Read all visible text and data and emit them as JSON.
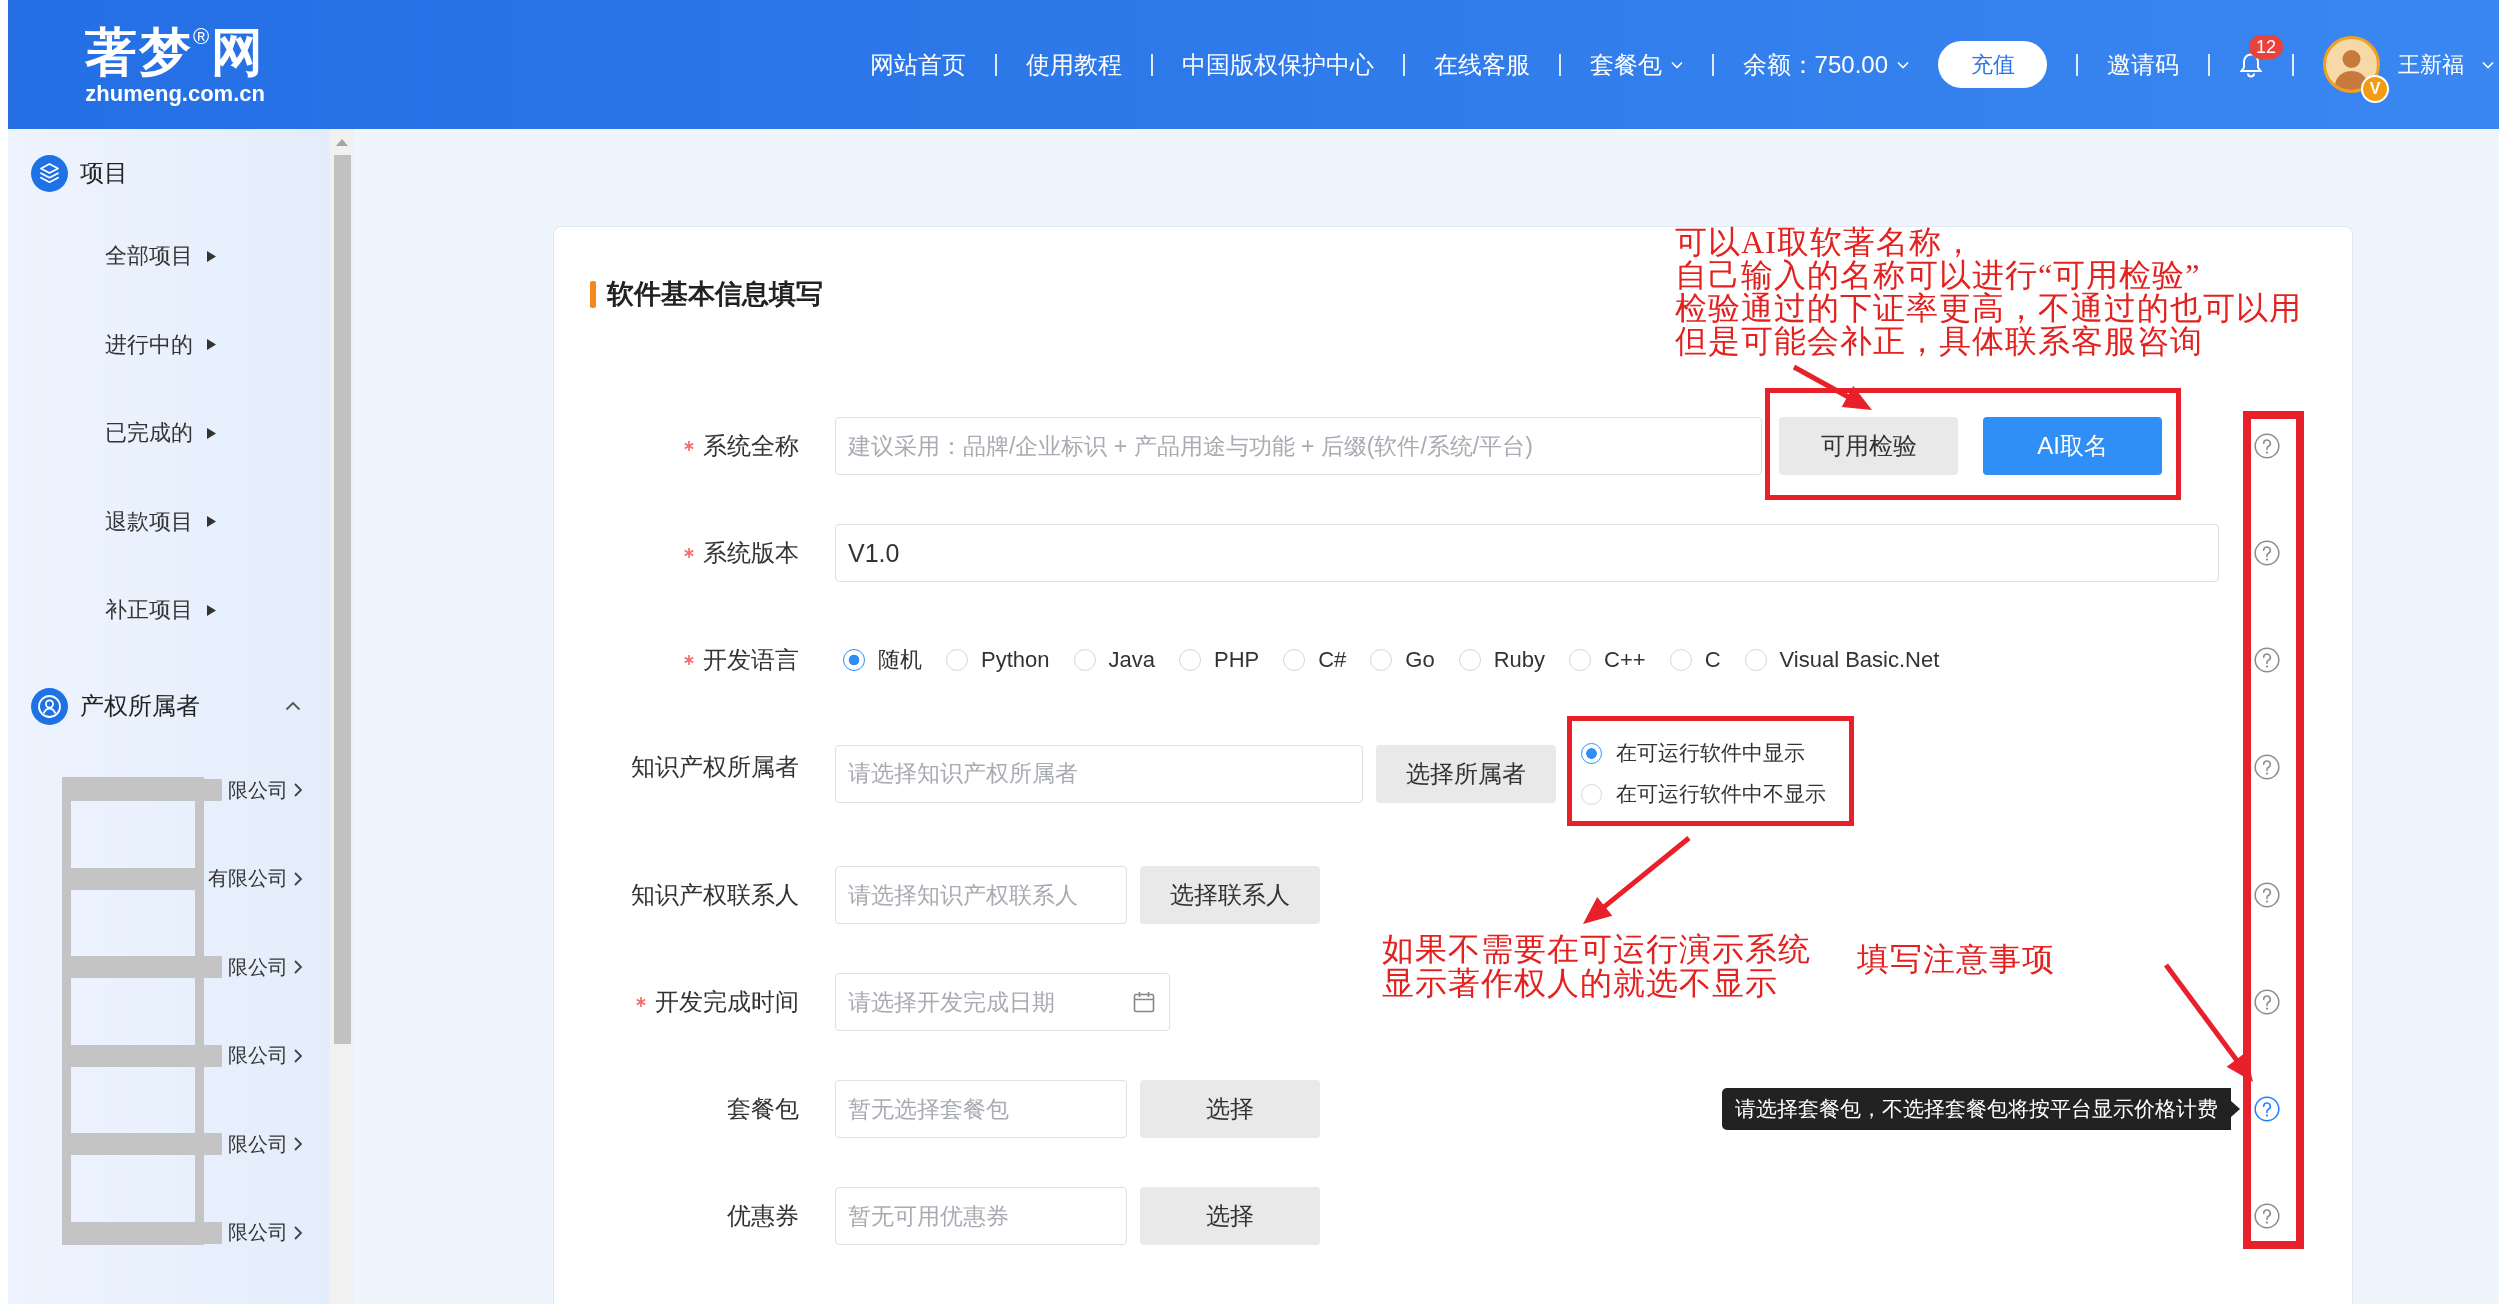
{
  "header": {
    "logo": "著梦$^{®}$网",
    "domain": "zhumeng.com.cn",
    "nav": [
      {
        "label": "网站首页",
        "dropdown": false
      },
      {
        "label": "使用教程",
        "dropdown": false
      },
      {
        "label": "中国版权保护中心",
        "dropdown": false
      },
      {
        "label": "在线客服",
        "dropdown": false
      },
      {
        "label": "套餐包",
        "dropdown": true
      },
      {
        "label": "余额：750.00",
        "dropdown": true
      }
    ],
    "recharge_button": "充值",
    "invite_link": "邀请码",
    "notifications": {
      "count": "12"
    },
    "user": {
      "name": "王新福",
      "badge": "V",
      "dropdown": true
    }
  },
  "sidebar": {
    "sections": [
      {
        "kind": "projects",
        "title": "项目",
        "items": [
          {
            "label": "全部项目"
          },
          {
            "label": "进行中的"
          },
          {
            "label": "已完成的"
          },
          {
            "label": "退款项目"
          },
          {
            "label": "补正项目"
          }
        ]
      },
      {
        "kind": "owners",
        "title": "产权所属者",
        "expanded": true,
        "items": [
          {
            "label": "限公司",
            "redacted": true
          },
          {
            "label": "有限公司",
            "redacted": true
          },
          {
            "label": "限公司",
            "redacted": true
          },
          {
            "label": "限公司",
            "redacted": true
          },
          {
            "label": "限公司",
            "redacted": true
          },
          {
            "label": "限公司",
            "redacted": true
          }
        ]
      }
    ]
  },
  "form": {
    "title": "软件基本信息填写",
    "rows": [
      {
        "kind": "name",
        "label": "系统全称",
        "required": true,
        "placeholder": "建议采用：品牌/企业标识 + 产品用途与功能 + 后缀(软件/系统/平台)",
        "buttons": [
          {
            "label": "可用检验",
            "primary": false
          },
          {
            "label": "AI取名",
            "primary": true
          }
        ],
        "help_active": false
      },
      {
        "kind": "text",
        "label": "系统版本",
        "required": true,
        "value": "V1.0",
        "help_active": false
      },
      {
        "kind": "radios",
        "label": "开发语言",
        "required": true,
        "options": [
          {
            "label": "随机",
            "selected": true
          },
          {
            "label": "Python",
            "selected": false
          },
          {
            "label": "Java",
            "selected": false
          },
          {
            "label": "PHP",
            "selected": false
          },
          {
            "label": "C#",
            "selected": false
          },
          {
            "label": "Go",
            "selected": false
          },
          {
            "label": "Ruby",
            "selected": false
          },
          {
            "label": "C++",
            "selected": false
          },
          {
            "label": "C",
            "selected": false
          },
          {
            "label": "Visual Basic.Net",
            "selected": false
          }
        ],
        "help_active": false
      },
      {
        "kind": "picker",
        "label": "知识产权所属者",
        "required": false,
        "placeholder": "请选择知识产权所属者",
        "buttons": [
          {
            "label": "选择所属者",
            "primary": false
          }
        ],
        "options": [
          {
            "label": "在可运行软件中显示",
            "selected": true
          },
          {
            "label": "在可运行软件中不显示",
            "selected": false
          }
        ],
        "help_active": false
      },
      {
        "kind": "picker",
        "label": "知识产权联系人",
        "required": false,
        "placeholder": "请选择知识产权联系人",
        "buttons": [
          {
            "label": "选择联系人",
            "primary": false
          }
        ],
        "help_active": false
      },
      {
        "kind": "date",
        "label": "开发完成时间",
        "required": true,
        "placeholder": "请选择开发完成日期",
        "help_active": false
      },
      {
        "kind": "picker",
        "label": "套餐包",
        "required": false,
        "placeholder": "暂无选择套餐包",
        "buttons": [
          {
            "label": "选择",
            "primary": false
          }
        ],
        "help_active": true,
        "tooltip": "请选择套餐包，不选择套餐包将按平台显示价格计费"
      },
      {
        "kind": "picker",
        "label": "优惠券",
        "required": false,
        "placeholder": "暂无可用优惠券",
        "buttons": [
          {
            "label": "选择",
            "primary": false
          }
        ],
        "help_active": false
      }
    ]
  },
  "annotations": [
    {
      "lines": [
        "可以AI取软著名称，",
        "自己输入的名称可以进行“可用检验”",
        "检验通过的下证率更高，不通过的也可以用",
        "但是可能会补正，具体联系客服咨询"
      ]
    },
    {
      "lines": [
        "如果不需要在可运行演示系统",
        "显示著作权人的就选不显示"
      ]
    },
    {
      "lines": [
        "填写注意事项"
      ]
    }
  ]
}
